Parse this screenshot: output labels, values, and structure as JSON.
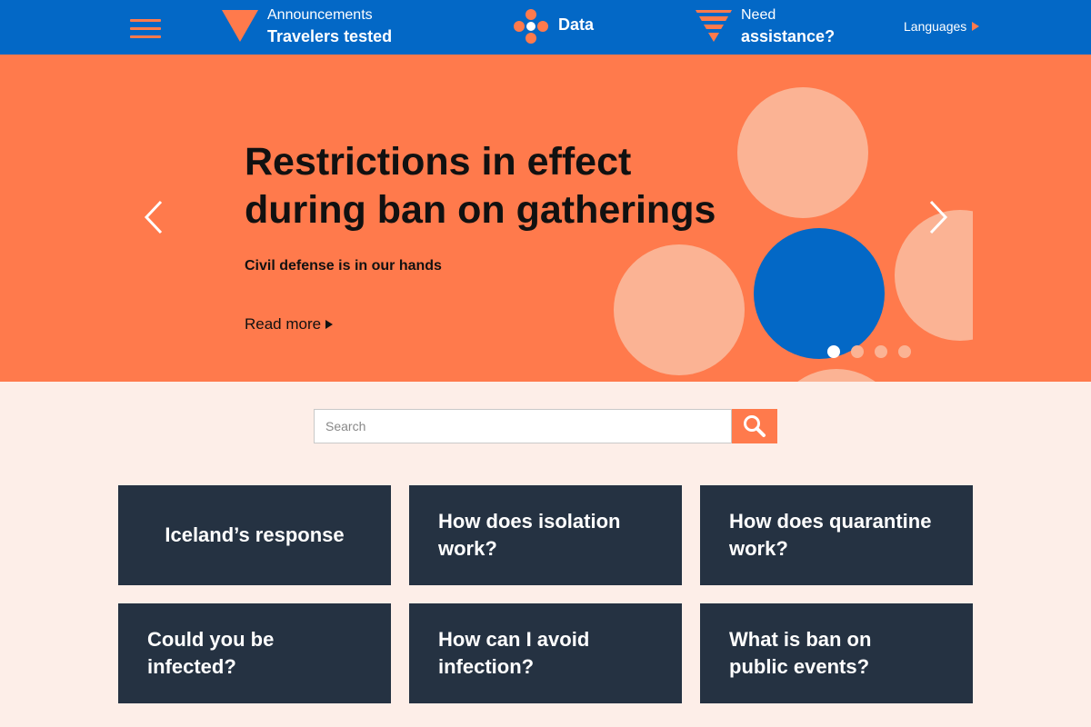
{
  "header": {
    "announcements": {
      "line1": "Announcements",
      "line2": "Travelers tested"
    },
    "data_label": "Data",
    "assistance": {
      "line1": "Need",
      "line2": "assistance?"
    },
    "languages_label": "Languages"
  },
  "hero": {
    "title_line1": "Restrictions in effect",
    "title_line2": "during ban on gatherings",
    "subtitle": "Civil defense is in our hands",
    "read_more": "Read more",
    "slide_count": 4,
    "active_slide": 1
  },
  "search": {
    "placeholder": "Search"
  },
  "cards": [
    {
      "label": "Iceland’s response"
    },
    {
      "label": "How does isolation work?"
    },
    {
      "label": "How does quarantine work?"
    },
    {
      "label": "Could you be infected?"
    },
    {
      "label": "How can I avoid infection?"
    },
    {
      "label": "What is ban on public events?"
    }
  ],
  "colors": {
    "brand_blue": "#0368c6",
    "accent_orange": "#ff7a4c",
    "card_navy": "#253242",
    "page_bg": "#fdeee8",
    "circle_peach": "#fbb394"
  }
}
